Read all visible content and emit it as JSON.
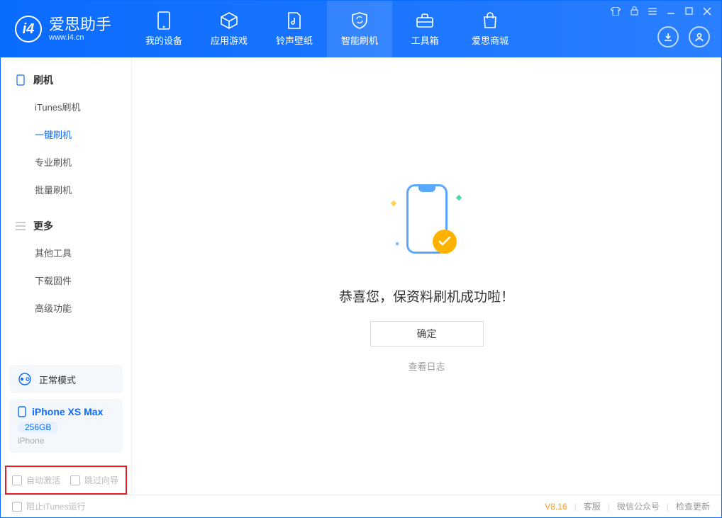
{
  "app": {
    "logo_letter": "i4",
    "name": "爱思助手",
    "domain": "www.i4.cn"
  },
  "nav": {
    "tabs": [
      {
        "label": "我的设备"
      },
      {
        "label": "应用游戏"
      },
      {
        "label": "铃声壁纸"
      },
      {
        "label": "智能刷机"
      },
      {
        "label": "工具箱"
      },
      {
        "label": "爱思商城"
      }
    ]
  },
  "sidebar": {
    "group1": {
      "title": "刷机"
    },
    "items1": [
      {
        "label": "iTunes刷机"
      },
      {
        "label": "一键刷机"
      },
      {
        "label": "专业刷机"
      },
      {
        "label": "批量刷机"
      }
    ],
    "group2": {
      "title": "更多"
    },
    "items2": [
      {
        "label": "其他工具"
      },
      {
        "label": "下载固件"
      },
      {
        "label": "高级功能"
      }
    ],
    "status_mode": "正常模式",
    "device": {
      "name": "iPhone XS Max",
      "capacity": "256GB",
      "type": "iPhone"
    },
    "opts": {
      "auto_activate": "自动激活",
      "skip_guide": "跳过向导"
    }
  },
  "main": {
    "success_text": "恭喜您，保资料刷机成功啦！",
    "ok_btn": "确定",
    "view_log": "查看日志"
  },
  "statusbar": {
    "block_itunes": "阻止iTunes运行",
    "version": "V8.16",
    "links": {
      "support": "客服",
      "wechat": "微信公众号",
      "update": "检查更新"
    }
  }
}
